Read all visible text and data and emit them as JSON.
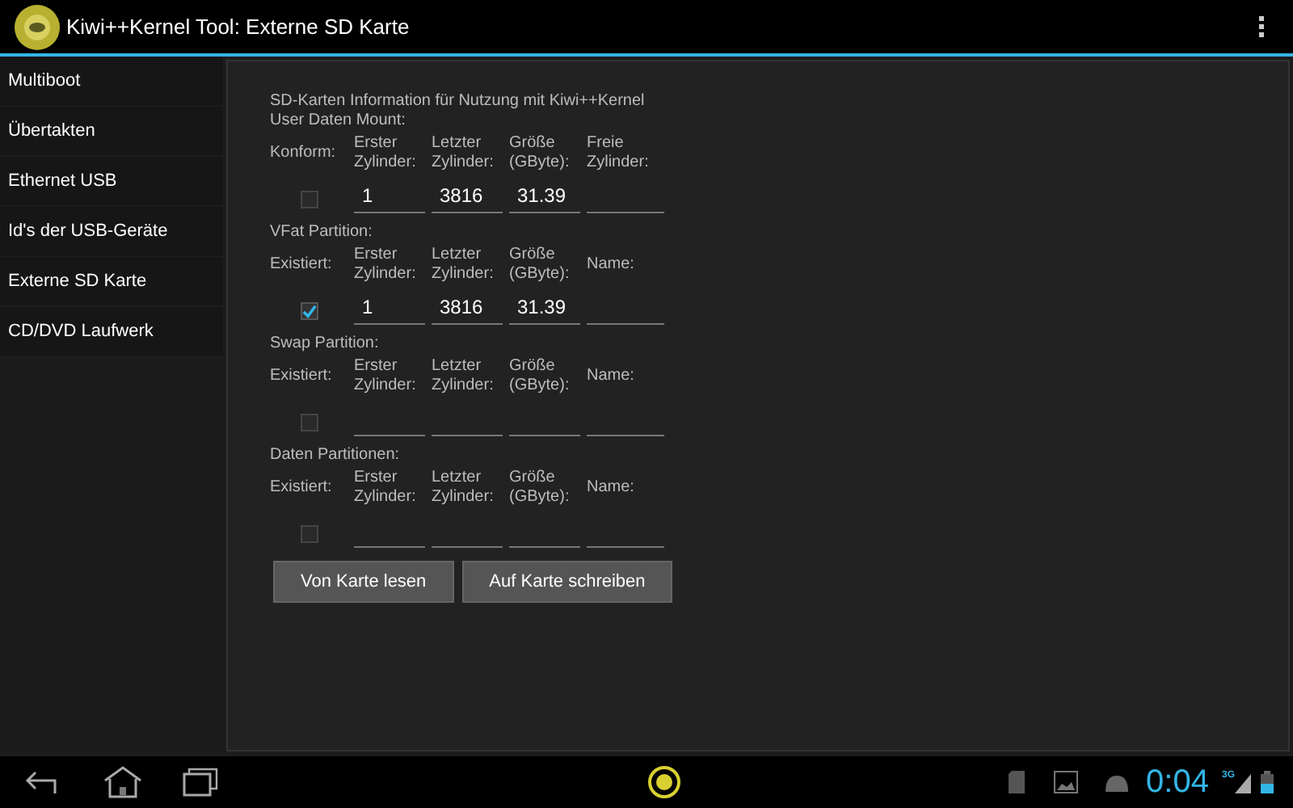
{
  "action_bar": {
    "title": "Kiwi++Kernel Tool: Externe SD Karte"
  },
  "sidebar": {
    "items": [
      "Multiboot",
      "Übertakten",
      "Ethernet USB",
      "Id's der USB-Geräte",
      "Externe SD Karte",
      "CD/DVD Laufwerk"
    ]
  },
  "content": {
    "heading": "SD-Karten Information für Nutzung mit Kiwi++Kernel",
    "sections": [
      {
        "title": "User Daten Mount:",
        "check_label": "Konform:",
        "checked": false,
        "fields": [
          {
            "label": "Erster Zylinder:",
            "value": "1"
          },
          {
            "label": "Letzter Zylinder:",
            "value": "3816"
          },
          {
            "label": "Größe (GByte):",
            "value": "31.39"
          },
          {
            "label": "Freie Zylinder:"
          }
        ]
      },
      {
        "title": "VFat Partition:",
        "check_label": "Existiert:",
        "checked": true,
        "fields": [
          {
            "label": "Erster Zylinder:",
            "value": "1"
          },
          {
            "label": "Letzter Zylinder:",
            "value": "3816"
          },
          {
            "label": "Größe (GByte):",
            "value": "31.39"
          },
          {
            "label": "Name:"
          }
        ]
      },
      {
        "title": "Swap Partition:",
        "check_label": "Existiert:",
        "checked": false,
        "fields": [
          {
            "label": "Erster Zylinder:"
          },
          {
            "label": "Letzter Zylinder:"
          },
          {
            "label": "Größe (GByte):"
          },
          {
            "label": "Name:"
          }
        ]
      },
      {
        "title": "Daten Partitionen:",
        "check_label": "Existiert:",
        "checked": false,
        "fields": [
          {
            "label": "Erster Zylinder:"
          },
          {
            "label": "Letzter Zylinder:"
          },
          {
            "label": "Größe (GByte):"
          },
          {
            "label": "Name:"
          }
        ]
      }
    ],
    "buttons": [
      "Von Karte lesen",
      "Auf Karte schreiben"
    ]
  },
  "system_bar": {
    "clock": "0:04",
    "network": "3G"
  }
}
